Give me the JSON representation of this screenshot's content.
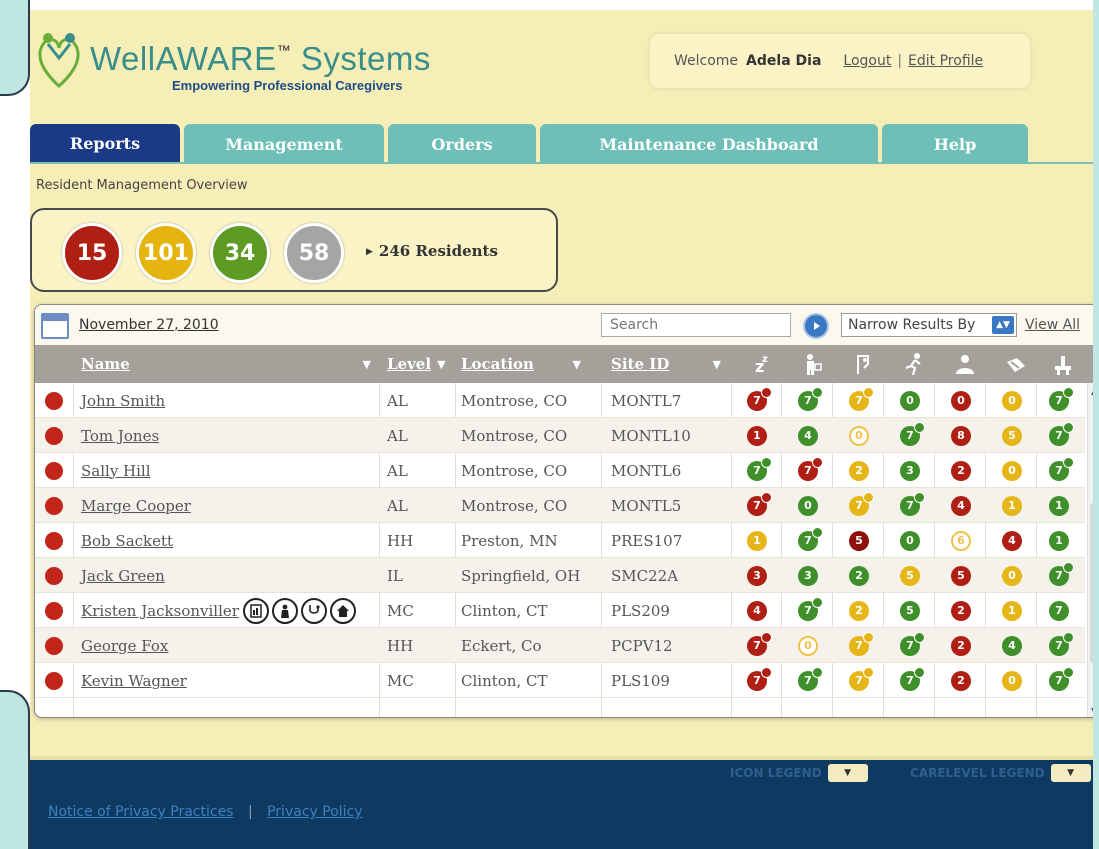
{
  "brand": {
    "title": "WellAWARE",
    "trademark": "™",
    "suffix": " Systems",
    "tagline": "Empowering Professional Caregivers"
  },
  "header": {
    "welcome": "Welcome",
    "user_name": "Adela Dia",
    "logout": "Logout",
    "separator": "|",
    "edit_profile": "Edit Profile"
  },
  "tabs": [
    {
      "label": "Reports",
      "active": true
    },
    {
      "label": "Management",
      "active": false
    },
    {
      "label": "Orders",
      "active": false
    },
    {
      "label": "Maintenance Dashboard",
      "active": false
    },
    {
      "label": "Help",
      "active": false
    }
  ],
  "breadcrumb": "Resident Management Overview",
  "summary": {
    "counts": [
      "15",
      "101",
      "34",
      "58"
    ],
    "colors": [
      "#b01f14",
      "#e5b40e",
      "#5d9b24",
      "#a5a5a5"
    ],
    "residents_label": "246 Residents"
  },
  "toolbar": {
    "date": "November 27, 2010",
    "search_placeholder": "Search",
    "narrow_label": "Narrow Results By",
    "view_all": "View All"
  },
  "table": {
    "headers": {
      "name": "Name",
      "level": "Level",
      "location": "Location",
      "site_id": "Site ID"
    },
    "icon_columns": [
      "sleep-icon",
      "activity-icon",
      "bathroom-icon",
      "movement-icon",
      "caregiver-icon",
      "meals-icon",
      "visit-icon"
    ],
    "rows": [
      {
        "name": "John Smith",
        "level": "AL",
        "location": "Montrose, CO",
        "site_id": "MONTL7"
      },
      {
        "name": "Tom Jones",
        "level": "AL",
        "location": "Montrose, CO",
        "site_id": "MONTL10"
      },
      {
        "name": "Sally Hill",
        "level": "AL",
        "location": "Montrose, CO",
        "site_id": "MONTL6"
      },
      {
        "name": "Marge Cooper",
        "level": "AL",
        "location": "Montrose, CO",
        "site_id": "MONTL5"
      },
      {
        "name": "Bob Sackett",
        "level": "HH",
        "location": "Preston, MN",
        "site_id": "PRES107"
      },
      {
        "name": "Jack Green",
        "level": "IL",
        "location": "Springfield, OH",
        "site_id": "SMC22A"
      },
      {
        "name": "Kristen Jacksonviller",
        "level": "MC",
        "location": "Clinton, CT",
        "site_id": "PLS209"
      },
      {
        "name": "George Fox",
        "level": "HH",
        "location": "Eckert, Co",
        "site_id": "PCPV12"
      },
      {
        "name": "Kevin Wagner",
        "level": "MC",
        "location": "Clinton, CT",
        "site_id": "PLS109"
      }
    ],
    "status_glyphs": [
      [
        "7",
        "7",
        "7",
        "0",
        "0",
        "0",
        "7"
      ],
      [
        "1",
        "4",
        "0",
        "7",
        "8",
        "5",
        "7"
      ],
      [
        "7",
        "7",
        "2",
        "3",
        "2",
        "0",
        "7"
      ],
      [
        "7",
        "0",
        "7",
        "7",
        "4",
        "1",
        "1"
      ],
      [
        "1",
        "7",
        "5",
        "0",
        "6",
        "4",
        "1"
      ],
      [
        "3",
        "3",
        "2",
        "5",
        "5",
        "0",
        "7"
      ],
      [
        "4",
        "7",
        "2",
        "5",
        "2",
        "1",
        "7"
      ],
      [
        "7",
        "0",
        "7",
        "7",
        "2",
        "4",
        "7"
      ],
      [
        "7",
        "7",
        "7",
        "7",
        "2",
        "0",
        "7"
      ]
    ]
  },
  "footer": {
    "icon_legend": "ICON LEGEND",
    "carelevel_legend": "CARELEVEL LEGEND",
    "privacy_notice": "Notice of Privacy Practices",
    "separator": "|",
    "privacy_policy": "Privacy Policy"
  }
}
